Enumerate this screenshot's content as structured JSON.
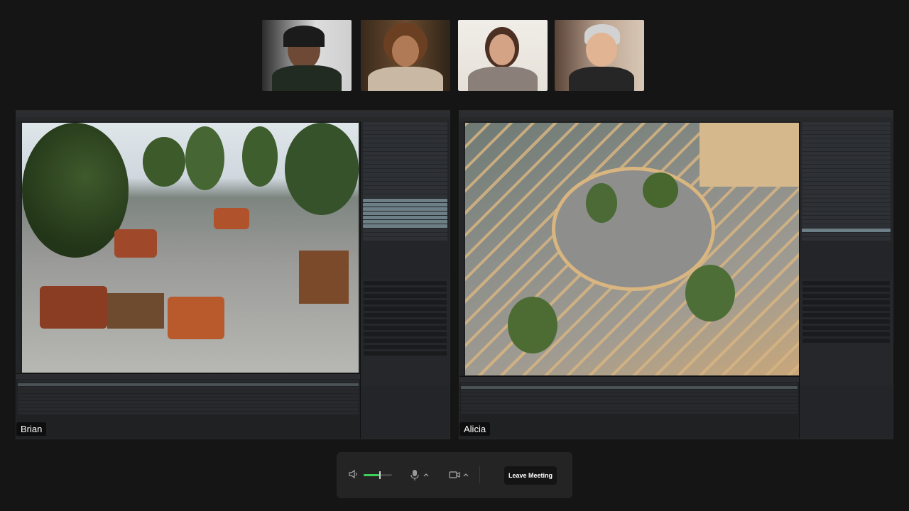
{
  "participants": [
    {
      "id": "p1",
      "description": "man with headphones"
    },
    {
      "id": "p2",
      "description": "woman with curly hair"
    },
    {
      "id": "p3",
      "description": "woman smiling"
    },
    {
      "id": "p4",
      "description": "avatar with glasses"
    }
  ],
  "shares": [
    {
      "presenter": "Brian",
      "viewport": "rooftop terrace with lounge chairs and trees"
    },
    {
      "presenter": "Alicia",
      "viewport": "aerial view of wooden pergola with circular opening"
    }
  ],
  "controls": {
    "speaker_icon": "speaker-icon",
    "volume_level": 0.55,
    "mic_icon": "microphone-icon",
    "camera_icon": "camera-icon",
    "leave_label": "Leave Meeting"
  },
  "colors": {
    "accent_volume": "#3ecf5a",
    "background": "#151515"
  }
}
